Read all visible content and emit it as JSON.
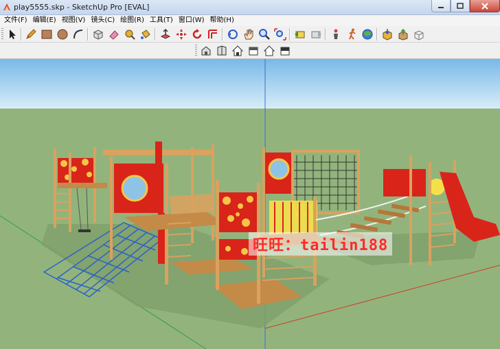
{
  "window": {
    "title": "play5555.skp - SketchUp Pro [EVAL]"
  },
  "menu": {
    "items": [
      "文件(F)",
      "编辑(E)",
      "视图(V)",
      "镜头(C)",
      "绘图(R)",
      "工具(T)",
      "窗口(W)",
      "帮助(H)"
    ]
  },
  "toolbar": {
    "main_tools": [
      "select-tool",
      "pencil-tool",
      "rectangle-tool",
      "circle-tool",
      "arc-tool",
      "make-component-tool",
      "eraser-tool",
      "tape-measure-tool",
      "paint-bucket-tool",
      "push-pull-tool",
      "move-tool",
      "rotate-tool",
      "offset-tool",
      "orbit-tool",
      "pan-tool",
      "zoom-tool",
      "zoom-extents-tool",
      "previous-view-tool",
      "next-view-tool",
      "position-camera-tool",
      "walk-tool",
      "look-around-tool",
      "get-models-tool",
      "share-model-tool",
      "share-component-tool",
      "google-earth-tool"
    ],
    "view_tools": [
      "iso-view",
      "top-view",
      "front-view",
      "right-view",
      "back-view",
      "left-view"
    ]
  },
  "viewport": {
    "watermark": "旺旺：tailin188",
    "colors": {
      "sky_top": "#79b9e8",
      "sky_bottom": "#d9ecf8",
      "ground": "#92b47c",
      "wood": "#d9a25e",
      "red_panel": "#d9241a",
      "green_axis": "#2f9e4a",
      "blue_axis": "#3b6dd6",
      "red_axis": "#d23a2a"
    }
  }
}
